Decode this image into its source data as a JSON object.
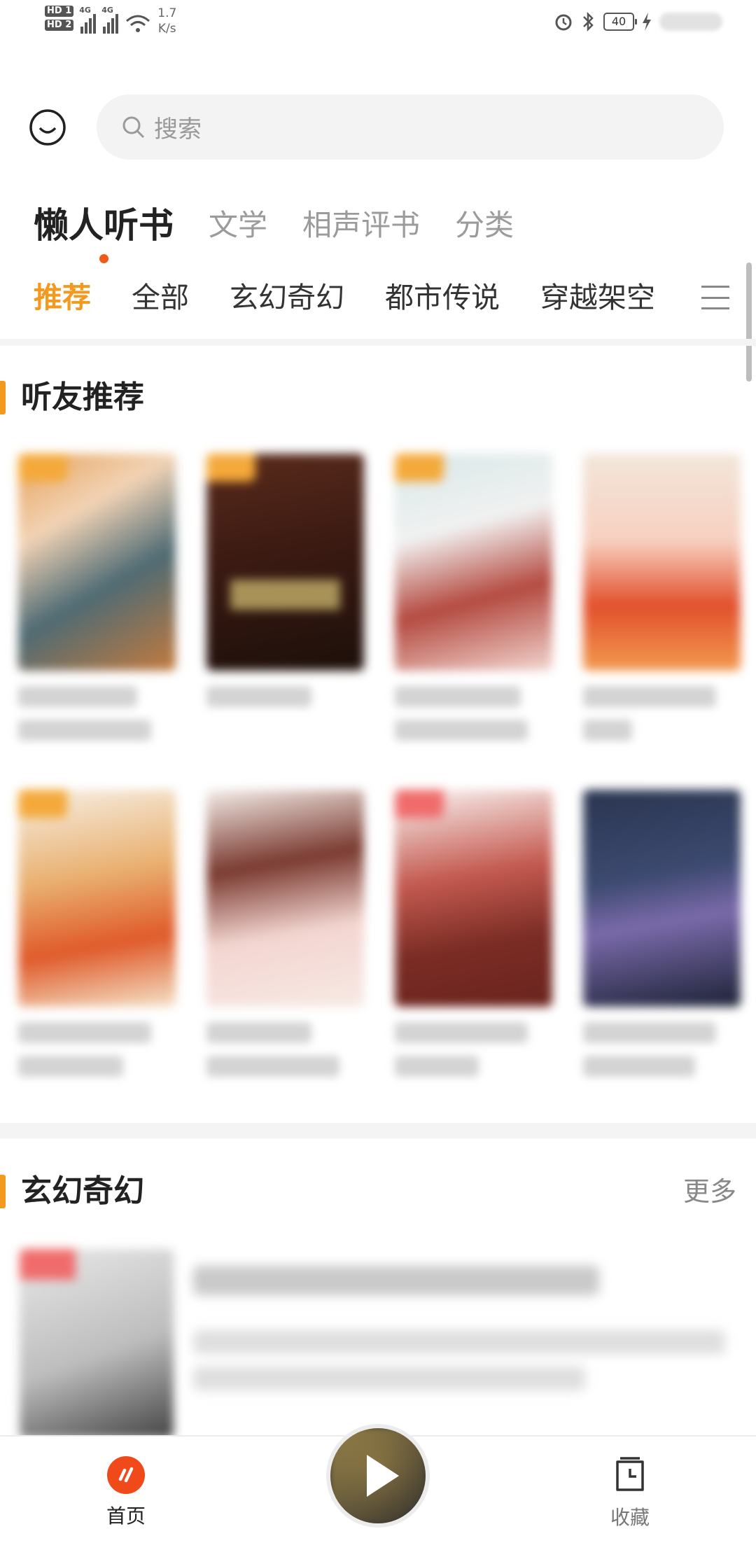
{
  "status_bar": {
    "sim1": "HD 1",
    "sim2": "HD 2",
    "net_type_1": "4G",
    "net_type_2": "4G",
    "speed_value": "1.7",
    "speed_unit": "K/s",
    "battery": "40"
  },
  "search": {
    "placeholder": "搜索"
  },
  "channels": [
    {
      "label": "懒人听书",
      "active": true
    },
    {
      "label": "文学"
    },
    {
      "label": "相声评书"
    },
    {
      "label": "分类"
    }
  ],
  "categories": [
    {
      "label": "推荐",
      "active": true
    },
    {
      "label": "全部"
    },
    {
      "label": "玄幻奇幻"
    },
    {
      "label": "都市传说"
    },
    {
      "label": "穿越架空"
    }
  ],
  "sections": {
    "recommend": {
      "title": "听友推荐"
    },
    "fantasy": {
      "title": "玄幻奇幻",
      "more": "更多"
    }
  },
  "bottom_nav": {
    "home": "首页",
    "favorites": "收藏"
  },
  "colors": {
    "accent": "#f39a1e",
    "brand": "#f04a1a"
  }
}
